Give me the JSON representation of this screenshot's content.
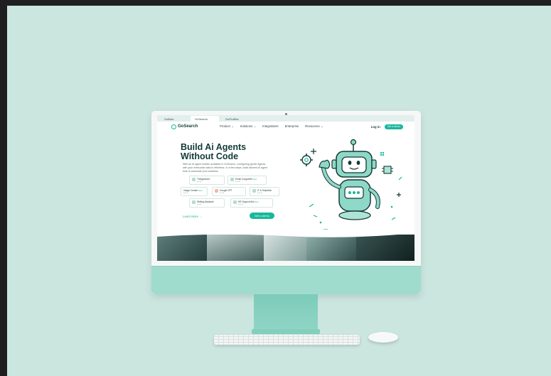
{
  "browser": {
    "tabs": [
      {
        "label": "GoBots",
        "active": false
      },
      {
        "label": "GoSearch",
        "active": true
      },
      {
        "label": "GoProfiles",
        "active": false
      }
    ]
  },
  "header": {
    "brand": "GoSearch",
    "menu": [
      "Product ⌄",
      "Solutions ⌄",
      "Integrations",
      "Enterprise",
      "Resources ⌄"
    ],
    "login_label": "Log in",
    "demo_label": "Get a demo"
  },
  "hero": {
    "title_line1": "Build Ai Agents",
    "title_line2": "Without Code",
    "description": "With an AI agent builder available in GoSearch, configuring genAI Agents with your enterprise data is effortless. In a few steps, build tailored AI agent bots to automate your workflow.",
    "learn_more_label": "Learn More →",
    "cta_label": "Get a demo",
    "cards": [
      {
        "title": "Thingsboard",
        "tag": "",
        "sub": "● ● ●"
      },
      {
        "title": "Email Copywriter",
        "tag": "New",
        "sub": "● ● ●"
      },
      {
        "title": "Image Creator",
        "tag": "New",
        "sub": "● ● ●"
      },
      {
        "title": "Google GPT",
        "tag": "",
        "sub": "● ● ●"
      },
      {
        "title": "IT & Helpdesk",
        "tag": "",
        "sub": "● ● ●"
      },
      {
        "title": "Writing Assistant",
        "tag": "",
        "sub": "● ● ●"
      },
      {
        "title": "HR Support Bot",
        "tag": "New",
        "sub": "● ● ●"
      }
    ]
  },
  "colors": {
    "accent": "#17b89a",
    "background": "#cbe5df",
    "imac_body": "#9fdccd",
    "dark_text": "#123a35"
  },
  "icons": [
    "robot-mascot-icon",
    "gear-icon",
    "chip-icon",
    "logo-icon"
  ]
}
